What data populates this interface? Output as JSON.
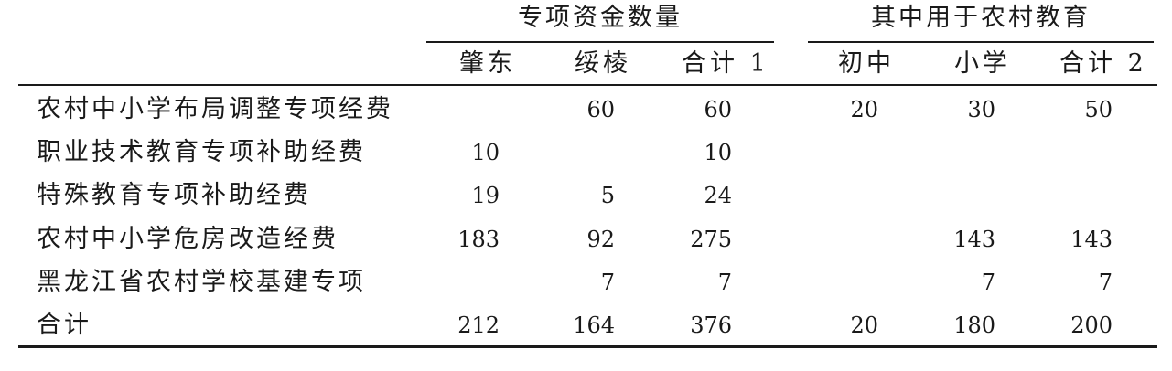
{
  "table": {
    "groups": [
      "专项资金数量",
      "其中用于农村教育"
    ],
    "columns": [
      "肇东",
      "绥棱",
      "合计 1",
      "初中",
      "小学",
      "合计 2"
    ],
    "rows": [
      {
        "label": "农村中小学布局调整专项经费",
        "cells": [
          "",
          "60",
          "60",
          "20",
          "30",
          "50"
        ]
      },
      {
        "label": "职业技术教育专项补助经费",
        "cells": [
          "10",
          "",
          "10",
          "",
          "",
          ""
        ]
      },
      {
        "label": "特殊教育专项补助经费",
        "cells": [
          "19",
          "5",
          "24",
          "",
          "",
          ""
        ]
      },
      {
        "label": "农村中小学危房改造经费",
        "cells": [
          "183",
          "92",
          "275",
          "",
          "143",
          "143"
        ]
      },
      {
        "label": "黑龙江省农村学校基建专项",
        "cells": [
          "",
          "7",
          "7",
          "",
          "7",
          "7"
        ]
      },
      {
        "label": "合计",
        "cells": [
          "212",
          "164",
          "376",
          "20",
          "180",
          "200"
        ]
      }
    ]
  }
}
